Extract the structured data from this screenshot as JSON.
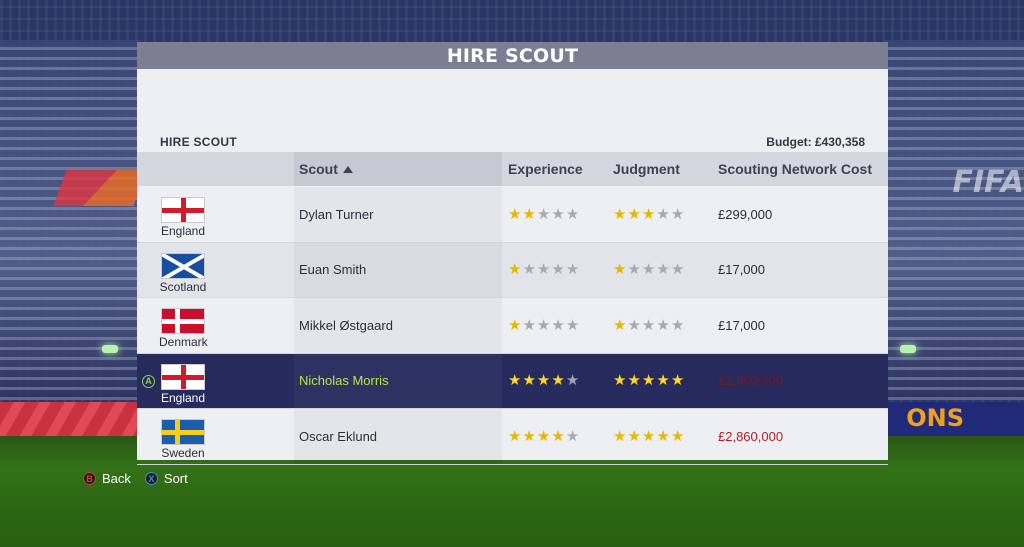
{
  "header": {
    "title": "HIRE SCOUT"
  },
  "subbar": {
    "label": "HIRE SCOUT",
    "budget": "Budget: £430,358"
  },
  "columns": {
    "scout": "Scout",
    "experience": "Experience",
    "judgment": "Judgment",
    "cost": "Scouting Network Cost"
  },
  "rows": [
    {
      "country": "England",
      "flag": "england-flag",
      "name": "Dylan Turner",
      "experience": 2,
      "judgment": 3,
      "cost": "£299,000",
      "cost_affordable": true
    },
    {
      "country": "Scotland",
      "flag": "scotland-flag",
      "name": "Euan Smith",
      "experience": 1,
      "judgment": 1,
      "cost": "£17,000",
      "cost_affordable": true
    },
    {
      "country": "Denmark",
      "flag": "denmark-flag",
      "name": "Mikkel Østgaard",
      "experience": 1,
      "judgment": 1,
      "cost": "£17,000",
      "cost_affordable": true
    },
    {
      "country": "England",
      "flag": "england-flag",
      "name": "Nicholas Morris",
      "experience": 4,
      "judgment": 5,
      "cost": "£2,860,000",
      "cost_affordable": false,
      "selected": true,
      "button_glyph": "A"
    },
    {
      "country": "Sweden",
      "flag": "sweden-flag",
      "name": "Oscar Eklund",
      "experience": 4,
      "judgment": 5,
      "cost": "£2,860,000",
      "cost_affordable": false
    }
  ],
  "footer": {
    "back": {
      "glyph": "B",
      "label": "Back"
    },
    "sort": {
      "glyph": "X",
      "label": "Sort"
    }
  },
  "background": {
    "stadium_logo": "FIFA",
    "board_text": "ONS"
  },
  "colors": {
    "header_bg": "#7b7f91",
    "selected_row_bg": "#262a5c",
    "selected_name": "#b7e34b",
    "unaffordable_cost": "#b31f2d",
    "star_on": "#e6b800"
  },
  "star_max": 5
}
